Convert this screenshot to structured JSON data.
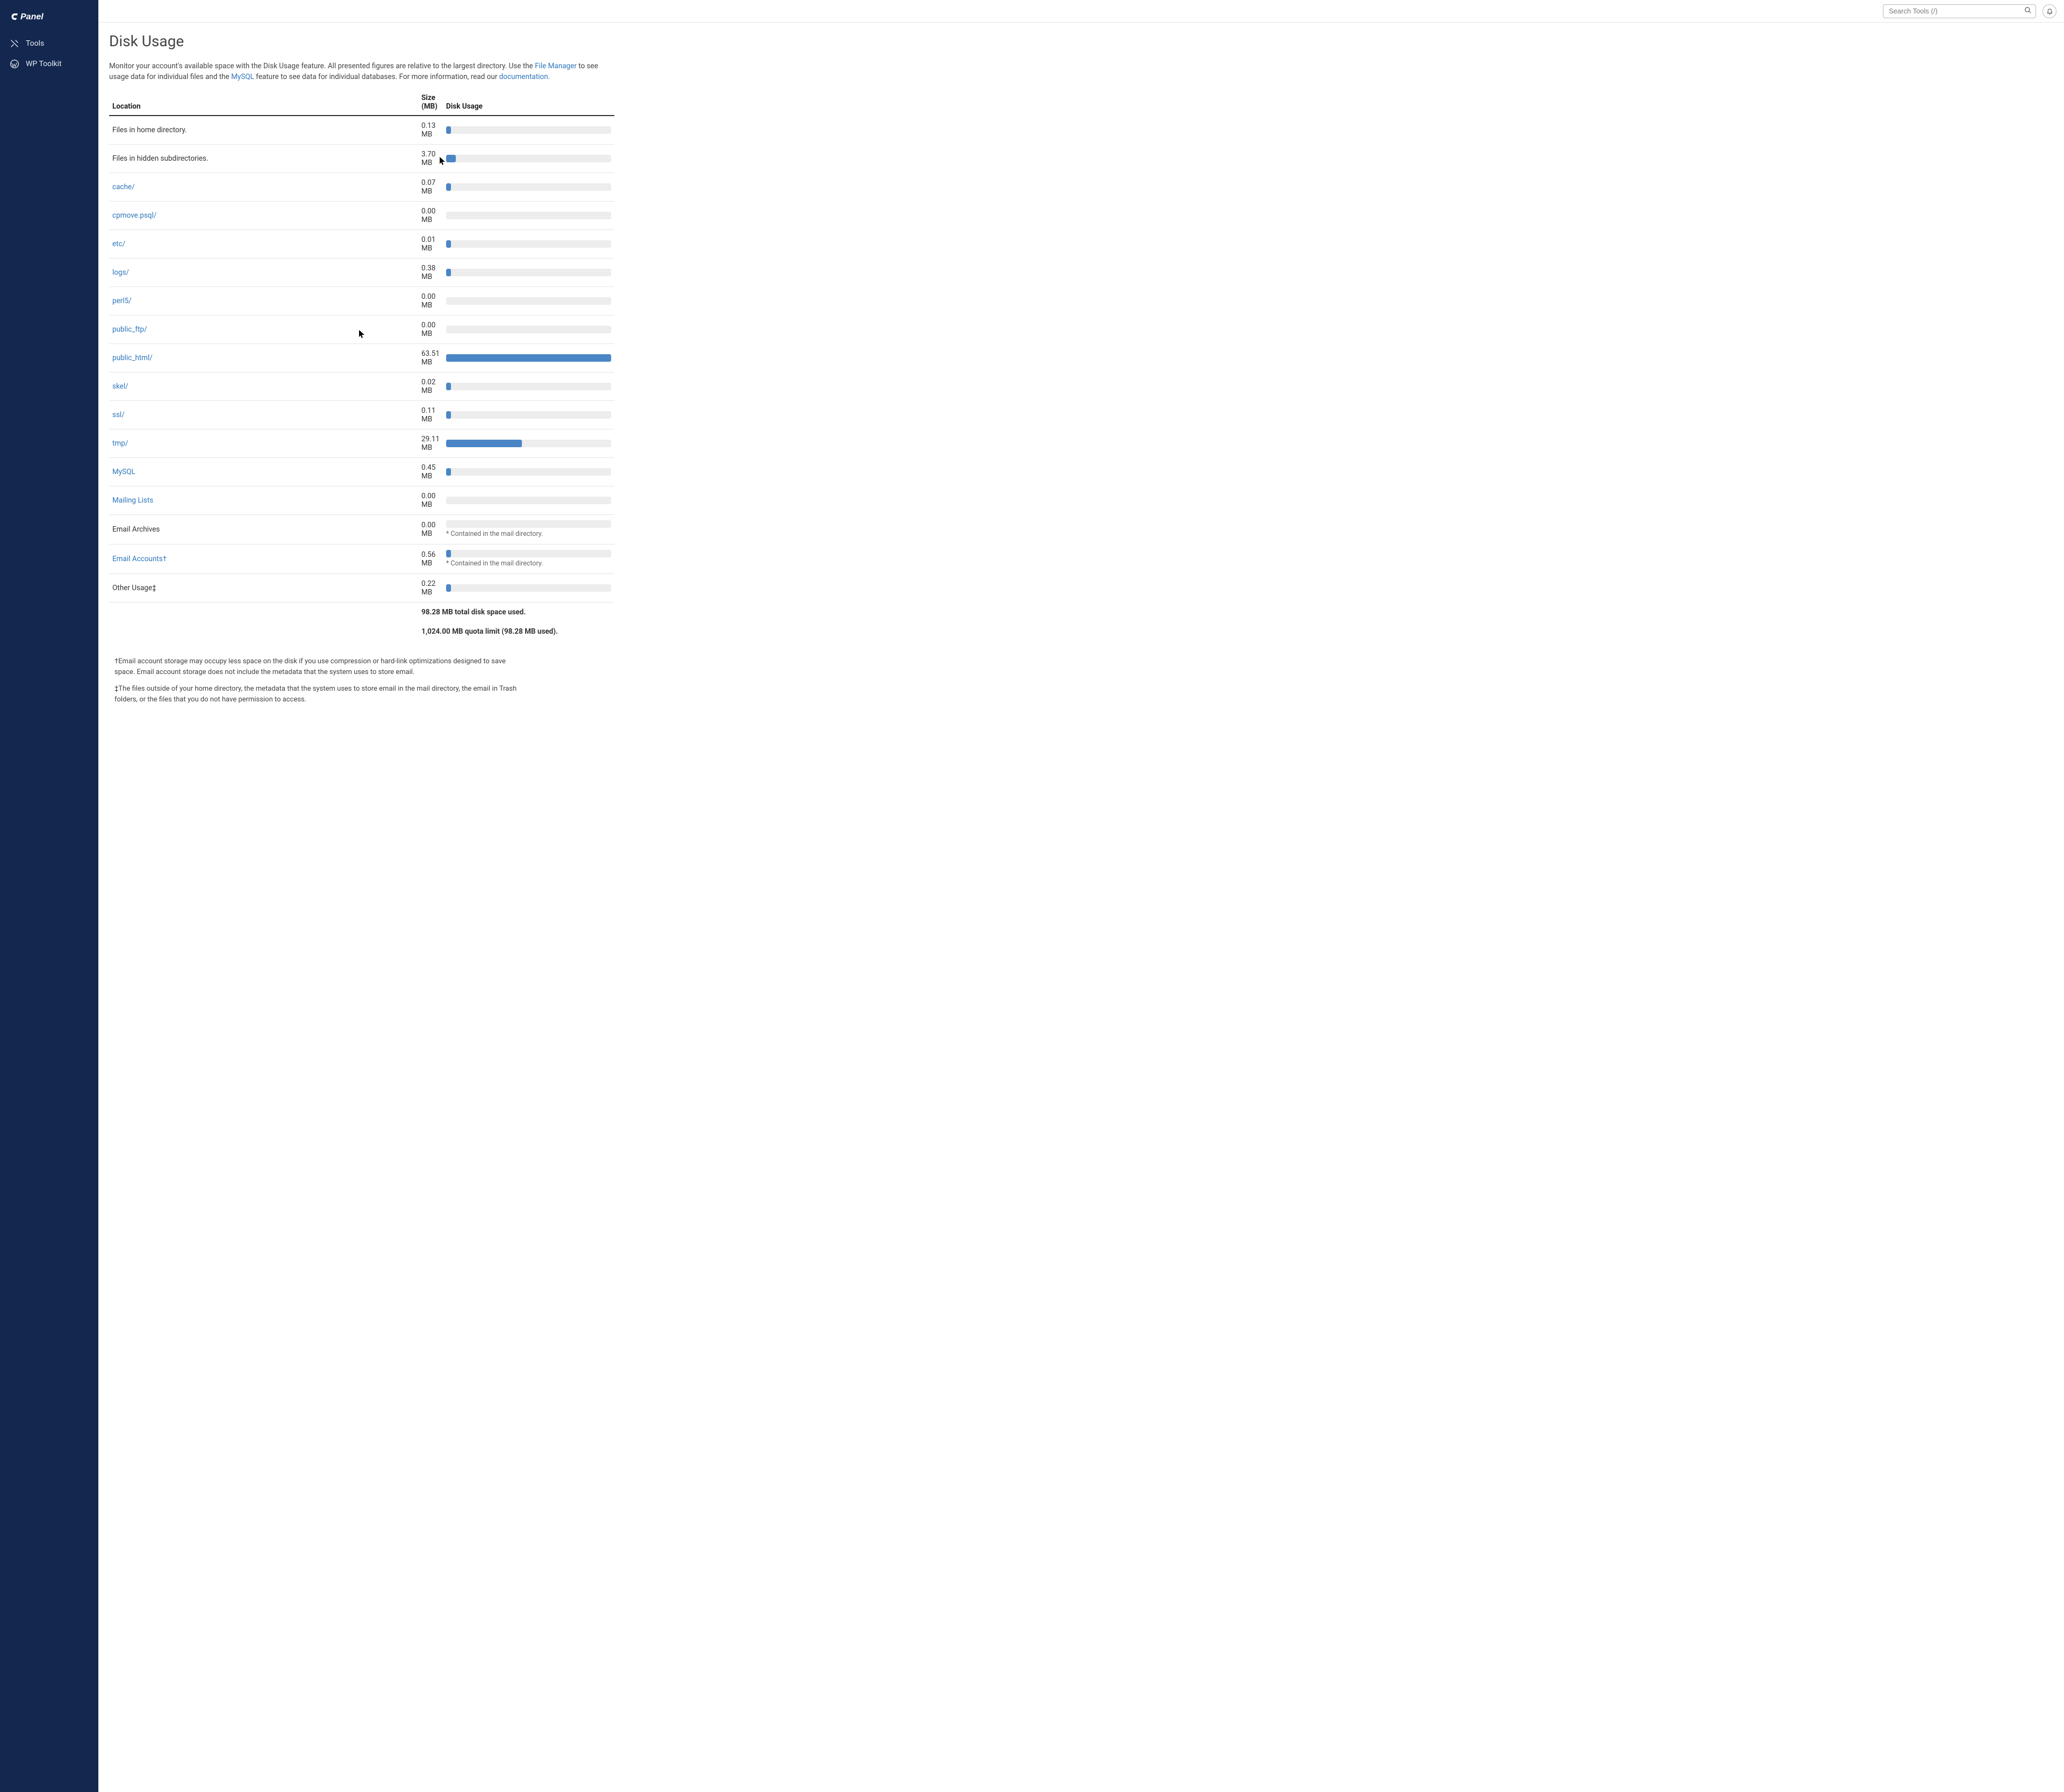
{
  "brand": "cPanel",
  "sidebar": {
    "items": [
      {
        "label": "Tools"
      },
      {
        "label": "WP Toolkit"
      }
    ]
  },
  "topbar": {
    "search_placeholder": "Search Tools (/)"
  },
  "page": {
    "title": "Disk Usage",
    "intro_pre": "Monitor your account's available space with the Disk Usage feature. All presented figures are relative to the largest directory. Use the ",
    "intro_link_fm": "File Manager",
    "intro_mid": " to see usage data for individual files and the ",
    "intro_link_mysql": "MySQL",
    "intro_post1": " feature to see data for individual databases. For more information, read our ",
    "intro_link_docs": "documentation",
    "intro_post2": "."
  },
  "table": {
    "headers": {
      "location": "Location",
      "size": "Size (MB)",
      "usage": "Disk Usage"
    },
    "max_value_mb": 63.51,
    "rows": [
      {
        "label": "Files in home directory.",
        "link": false,
        "size": "0.13 MB",
        "mb": 0.13,
        "note": null
      },
      {
        "label": "Files in hidden subdirectories.",
        "link": false,
        "size": "3.70 MB",
        "mb": 3.7,
        "note": null
      },
      {
        "label": "cache/",
        "link": true,
        "size": "0.07 MB",
        "mb": 0.07,
        "note": null
      },
      {
        "label": "cpmove.psql/",
        "link": true,
        "size": "0.00 MB",
        "mb": 0.0,
        "note": null
      },
      {
        "label": "etc/",
        "link": true,
        "size": "0.01 MB",
        "mb": 0.01,
        "note": null
      },
      {
        "label": "logs/",
        "link": true,
        "size": "0.38 MB",
        "mb": 0.38,
        "note": null
      },
      {
        "label": "perl5/",
        "link": true,
        "size": "0.00 MB",
        "mb": 0.0,
        "note": null
      },
      {
        "label": "public_ftp/",
        "link": true,
        "size": "0.00 MB",
        "mb": 0.0,
        "note": null
      },
      {
        "label": "public_html/",
        "link": true,
        "size": "63.51 MB",
        "mb": 63.51,
        "note": null
      },
      {
        "label": "skel/",
        "link": true,
        "size": "0.02 MB",
        "mb": 0.02,
        "note": null
      },
      {
        "label": "ssl/",
        "link": true,
        "size": "0.11 MB",
        "mb": 0.11,
        "note": null
      },
      {
        "label": "tmp/",
        "link": true,
        "size": "29.11 MB",
        "mb": 29.11,
        "note": null
      },
      {
        "label": "MySQL",
        "link": true,
        "size": "0.45 MB",
        "mb": 0.45,
        "note": null
      },
      {
        "label": "Mailing Lists",
        "link": true,
        "size": "0.00 MB",
        "mb": 0.0,
        "note": null
      },
      {
        "label": "Email Archives",
        "link": false,
        "size": "0.00 MB",
        "mb": 0.0,
        "note": "* Contained in the mail directory."
      },
      {
        "label": "Email Accounts†",
        "link": true,
        "size": "0.56 MB",
        "mb": 0.56,
        "note": "* Contained in the mail directory."
      },
      {
        "label": "Other Usage‡",
        "link": false,
        "size": "0.22 MB",
        "mb": 0.22,
        "note": null
      }
    ],
    "total_used": "98.28 MB total disk space used.",
    "quota": "1,024.00 MB quota limit (98.28 MB used)."
  },
  "footnotes": {
    "dagger": "†Email account storage may occupy less space on the disk if you use compression or hard-link optimizations designed to save space. Email account storage does not include the metadata that the system uses to store email.",
    "ddagger": "‡The files outside of your home directory, the metadata that the system uses to store email in the mail directory, the email in Trash folders, or the files that you do not have permission to access."
  }
}
